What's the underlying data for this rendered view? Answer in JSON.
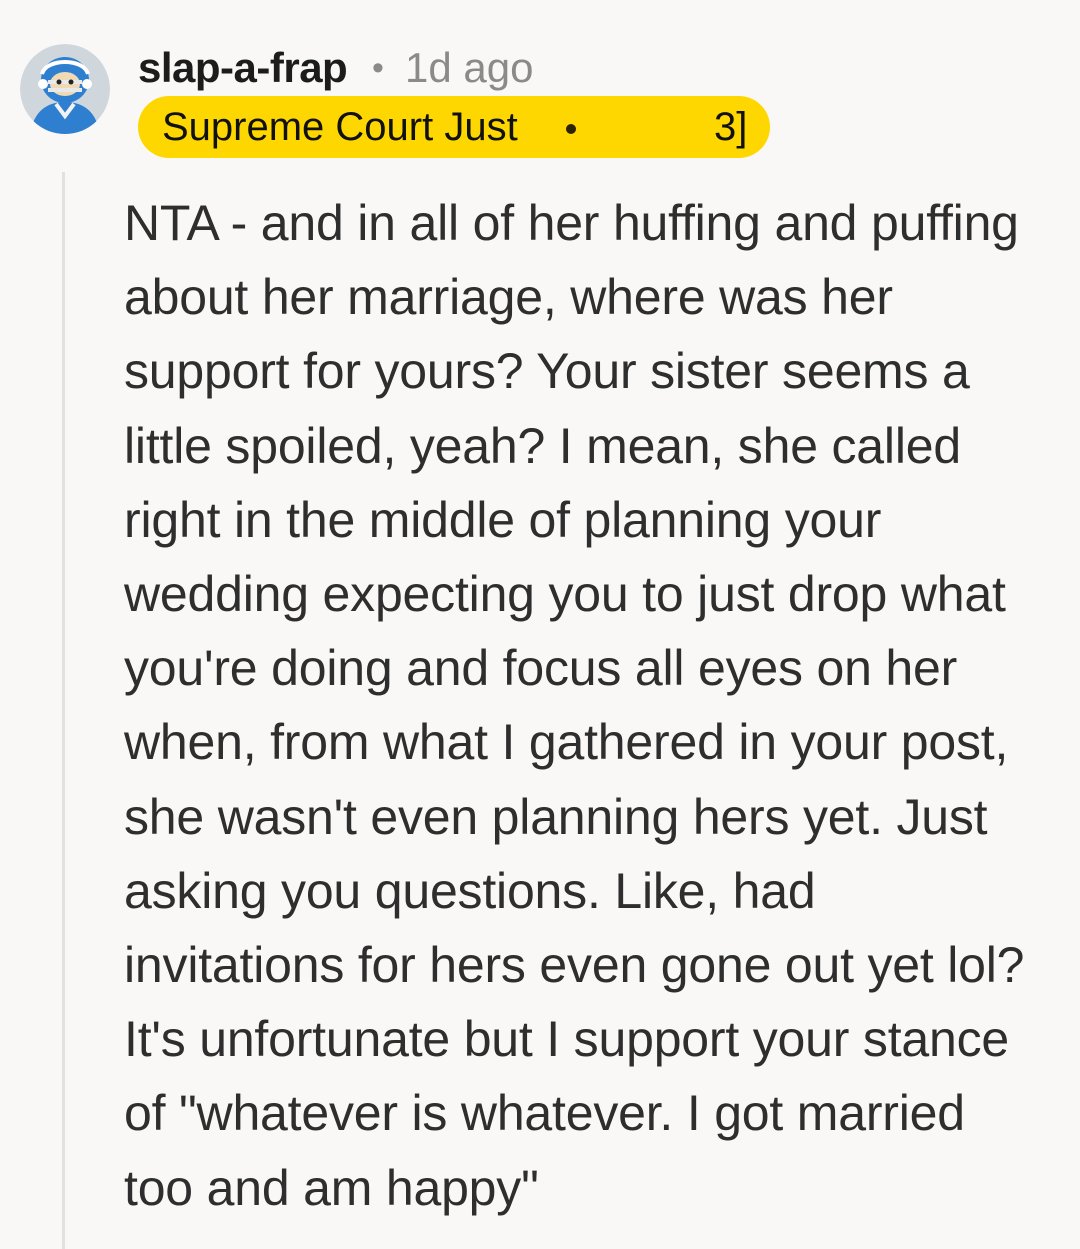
{
  "comment": {
    "author": "slap-a-frap",
    "separator": "•",
    "time_ago": "1d ago",
    "avatar_icon": "football-player-avatar-icon",
    "flair": {
      "text_visible_start": "Supreme Court Just",
      "text_visible_end": "3]",
      "background": "#ffd700"
    },
    "body_lines": [
      "NTA - and in all of her huffing and puffing",
      "about her marriage, where was her",
      "support for yours? Your sister seems a",
      "little spoiled, yeah? I mean, she called",
      "right in the middle of planning your",
      "wedding expecting you to just drop what",
      "you're doing and focus all eyes on her",
      "when, from what I gathered in your post,",
      "she wasn't even planning hers yet. Just",
      "asking you questions. Like, had",
      "invitations for hers even gone out yet lol?",
      "It's unfortunate but I support your stance",
      "of \"whatever is whatever. I got married",
      "too and am happy\""
    ]
  }
}
